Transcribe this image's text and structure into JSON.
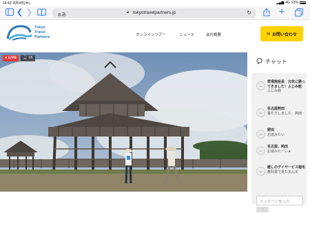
{
  "status_bar": {
    "time": "14:43",
    "date": "8月4日(木)",
    "signal": "4G",
    "battery": "91%"
  },
  "browser": {
    "aa_label": "ぁあ",
    "url": "tokyotravelpartners.jp",
    "icons": [
      "sidebar-icon",
      "back-icon",
      "forward-icon",
      "bookmarks-icon",
      "lock-icon",
      "reload-icon",
      "share-icon",
      "new-tab-icon",
      "tabs-icon"
    ]
  },
  "site": {
    "logo": {
      "line1": "Tokyo",
      "line2": "Travel",
      "line3": "Partners"
    },
    "nav": [
      "オンラインツアー",
      "ニュース",
      "会社概要"
    ],
    "contact_label": "お問い合わせ"
  },
  "video": {
    "live_label": "LIVE",
    "viewer_count": "35"
  },
  "chat": {
    "title": "チャット",
    "messages": [
      {
        "name": "草場施設長　元気に勝ってきました！ふじみ館",
        "text": "ふじみ館"
      },
      {
        "name": "名古屋熱田",
        "text": "暑たりしました　熱田"
      },
      {
        "name": "野田",
        "text": "お城みたい"
      },
      {
        "name": "名古屋、熱田",
        "text": "お城みたーい★"
      },
      {
        "name": "癒しのデイサービス稲毛",
        "text": "教科書で見たまんま"
      }
    ],
    "input_placeholder": "メッセージを入力",
    "send_label": "↑"
  },
  "colors": {
    "accent": "#2f7cf6",
    "live": "#e53935",
    "cta": "#ffd200",
    "brand": "#2b78b8"
  }
}
